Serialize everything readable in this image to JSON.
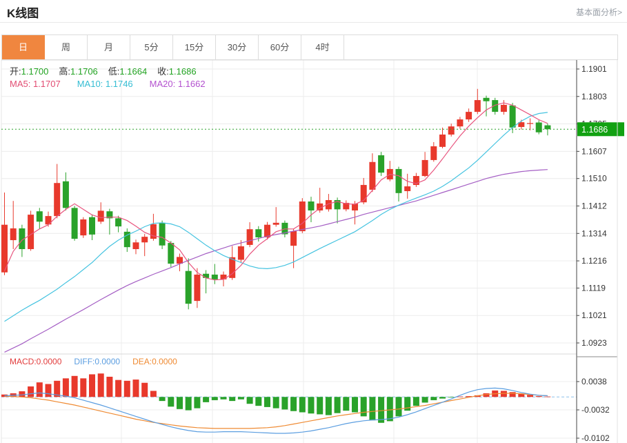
{
  "header": {
    "title": "K线图",
    "link_label": "基本面分析>"
  },
  "tabs": {
    "active_index": 0,
    "items": [
      "日",
      "周",
      "月",
      "5分",
      "15分",
      "30分",
      "60分",
      "4时"
    ]
  },
  "ohlc_bar": {
    "open_label": "开:",
    "open_value": "1.1700",
    "high_label": "高:",
    "high_value": "1.1706",
    "low_label": "低:",
    "low_value": "1.1664",
    "close_label": "收:",
    "close_value": "1.1686"
  },
  "ma_bar": {
    "ma5": "MA5: 1.1707",
    "ma10": "MA10: 1.1746",
    "ma20": "MA20: 1.1662"
  },
  "macd_bar": {
    "macd": "MACD:0.0000",
    "diff": "DIFF:0.0000",
    "dea": "DEA:0.0000"
  },
  "price_tag": "1.1686",
  "colors": {
    "up_red": "#e8392c",
    "down_green": "#2aa22a",
    "price_tag_bg": "#12a112",
    "value_green": "#21a321",
    "ma5_line": "#e8547e",
    "ma10_line": "#44c3e0",
    "ma20_line": "#a45ec4",
    "diff_line": "#5a9de0",
    "dea_line": "#ef8a32",
    "active_tab_bg": "#f0863f",
    "grid": "#ececec",
    "axis": "#444444",
    "zero_dash": "#8cc0ea"
  },
  "chart_data": {
    "type": "candlestick",
    "panes": [
      "price-with-ma",
      "macd"
    ],
    "legend": [
      "MA5",
      "MA10",
      "MA20",
      "MACD",
      "DIFF",
      "DEA"
    ],
    "grid": true,
    "y_ticks": [
      1.1901,
      1.1803,
      1.1705,
      1.1607,
      1.151,
      1.1412,
      1.1314,
      1.1216,
      1.1119,
      1.1021,
      1.0923
    ],
    "current_price": 1.1686,
    "last_ohlc": {
      "open": 1.17,
      "high": 1.1706,
      "low": 1.1664,
      "close": 1.1686
    },
    "candles_ohlc": [
      [
        1.1175,
        1.146,
        1.1165,
        1.1345
      ],
      [
        1.129,
        1.143,
        1.1258,
        1.1332
      ],
      [
        1.1332,
        1.1345,
        1.123,
        1.1258
      ],
      [
        1.1258,
        1.1395,
        1.1252,
        1.1381
      ],
      [
        1.1393,
        1.1405,
        1.133,
        1.1356
      ],
      [
        1.1346,
        1.1392,
        1.1338,
        1.1376
      ],
      [
        1.1376,
        1.1562,
        1.1368,
        1.1494
      ],
      [
        1.15,
        1.1532,
        1.1396,
        1.1405
      ],
      [
        1.1405,
        1.1412,
        1.1288,
        1.1295
      ],
      [
        1.1307,
        1.1372,
        1.1298,
        1.1364
      ],
      [
        1.1372,
        1.1382,
        1.129,
        1.131
      ],
      [
        1.1356,
        1.1425,
        1.1348,
        1.1395
      ],
      [
        1.1393,
        1.1402,
        1.131,
        1.1368
      ],
      [
        1.1368,
        1.1377,
        1.1318,
        1.1339
      ],
      [
        1.132,
        1.1332,
        1.1248,
        1.1265
      ],
      [
        1.1258,
        1.1292,
        1.124,
        1.1282
      ],
      [
        1.1282,
        1.1312,
        1.1233,
        1.1302
      ],
      [
        1.1295,
        1.1384,
        1.1288,
        1.1347
      ],
      [
        1.1352,
        1.136,
        1.1258,
        1.1271
      ],
      [
        1.128,
        1.1287,
        1.1194,
        1.1206
      ],
      [
        1.1206,
        1.1242,
        1.1179,
        1.123
      ],
      [
        1.118,
        1.1225,
        1.1043,
        1.1063
      ],
      [
        1.1073,
        1.119,
        1.1048,
        1.1167
      ],
      [
        1.117,
        1.1183,
        1.11,
        1.1155
      ],
      [
        1.1167,
        1.1205,
        1.1133,
        1.115
      ],
      [
        1.115,
        1.1178,
        1.1125,
        1.1167
      ],
      [
        1.1155,
        1.1269,
        1.1148,
        1.1229
      ],
      [
        1.122,
        1.129,
        1.121,
        1.1268
      ],
      [
        1.1273,
        1.1354,
        1.1265,
        1.1329
      ],
      [
        1.1329,
        1.134,
        1.1285,
        1.13
      ],
      [
        1.13,
        1.1355,
        1.1292,
        1.1345
      ],
      [
        1.1345,
        1.1408,
        1.1338,
        1.1352
      ],
      [
        1.1352,
        1.136,
        1.13,
        1.1311
      ],
      [
        1.127,
        1.133,
        1.119,
        1.1322
      ],
      [
        1.1322,
        1.144,
        1.1315,
        1.1428
      ],
      [
        1.1428,
        1.1445,
        1.1354,
        1.1396
      ],
      [
        1.1396,
        1.1477,
        1.1388,
        1.1421
      ],
      [
        1.14,
        1.1455,
        1.1392,
        1.1433
      ],
      [
        1.1433,
        1.1442,
        1.135,
        1.14
      ],
      [
        1.14,
        1.1432,
        1.1393,
        1.1423
      ],
      [
        1.1396,
        1.143,
        1.1346,
        1.142
      ],
      [
        1.1425,
        1.1512,
        1.1418,
        1.1487
      ],
      [
        1.147,
        1.16,
        1.1462,
        1.1569
      ],
      [
        1.1593,
        1.1605,
        1.1519,
        1.1531
      ],
      [
        1.1507,
        1.1573,
        1.15,
        1.1544
      ],
      [
        1.1544,
        1.1552,
        1.1428,
        1.1458
      ],
      [
        1.1465,
        1.1527,
        1.1438,
        1.1482
      ],
      [
        1.1487,
        1.153,
        1.148,
        1.1519
      ],
      [
        1.1519,
        1.1605,
        1.1515,
        1.1576
      ],
      [
        1.1576,
        1.164,
        1.157,
        1.1625
      ],
      [
        1.1623,
        1.1692,
        1.1618,
        1.1667
      ],
      [
        1.1667,
        1.1706,
        1.166,
        1.1696
      ],
      [
        1.1696,
        1.173,
        1.1688,
        1.1721
      ],
      [
        1.1721,
        1.176,
        1.1712,
        1.1748
      ],
      [
        1.1748,
        1.183,
        1.174,
        1.179
      ],
      [
        1.1798,
        1.1806,
        1.1732,
        1.1786
      ],
      [
        1.179,
        1.1798,
        1.1738,
        1.1748
      ],
      [
        1.1748,
        1.179,
        1.1738,
        1.1773
      ],
      [
        1.1771,
        1.178,
        1.1672,
        1.1692
      ],
      [
        1.1694,
        1.172,
        1.1685,
        1.1711
      ],
      [
        1.1705,
        1.1725,
        1.1682,
        1.1708
      ],
      [
        1.171,
        1.1718,
        1.1668,
        1.1675
      ],
      [
        1.17,
        1.1706,
        1.1664,
        1.1686
      ]
    ],
    "ma5": [
      1.118,
      1.125,
      1.129,
      1.131,
      1.133,
      1.1345,
      1.1375,
      1.14,
      1.142,
      1.14,
      1.138,
      1.137,
      1.1372,
      1.1372,
      1.136,
      1.134,
      1.1318,
      1.1305,
      1.13,
      1.128,
      1.1255,
      1.121,
      1.1175,
      1.1155,
      1.1148,
      1.115,
      1.117,
      1.12,
      1.124,
      1.1272,
      1.1295,
      1.132,
      1.133,
      1.133,
      1.135,
      1.138,
      1.1404,
      1.142,
      1.1428,
      1.142,
      1.1418,
      1.1432,
      1.1468,
      1.1505,
      1.1525,
      1.152,
      1.15,
      1.1492,
      1.1505,
      1.154,
      1.158,
      1.1622,
      1.1662,
      1.1697,
      1.1727,
      1.1755,
      1.1772,
      1.178,
      1.1772,
      1.1755,
      1.1738,
      1.172,
      1.1707
    ],
    "ma10": [
      1.1,
      1.102,
      1.104,
      1.1058,
      1.1075,
      1.1095,
      1.1115,
      1.1138,
      1.116,
      1.1185,
      1.121,
      1.124,
      1.1268,
      1.129,
      1.1308,
      1.1322,
      1.1338,
      1.135,
      1.1352,
      1.1348,
      1.1338,
      1.1318,
      1.1295,
      1.1272,
      1.1252,
      1.1235,
      1.1222,
      1.121,
      1.1198,
      1.119,
      1.1188,
      1.1192,
      1.12,
      1.1212,
      1.1228,
      1.1244,
      1.126,
      1.1275,
      1.129,
      1.1305,
      1.132,
      1.134,
      1.136,
      1.1382,
      1.14,
      1.1415,
      1.1428,
      1.144,
      1.1452,
      1.1465,
      1.1482,
      1.1502,
      1.1525,
      1.1548,
      1.1575,
      1.1605,
      1.1635,
      1.1665,
      1.1692,
      1.1715,
      1.1732,
      1.1742,
      1.1746
    ],
    "ma20": [
      1.089,
      1.0905,
      1.092,
      1.0938,
      1.0955,
      1.0972,
      1.099,
      1.1008,
      1.1025,
      1.1042,
      1.106,
      1.1078,
      1.1095,
      1.1112,
      1.1128,
      1.1142,
      1.1155,
      1.1168,
      1.118,
      1.1192,
      1.1205,
      1.1218,
      1.123,
      1.1242,
      1.1252,
      1.1262,
      1.1272,
      1.128,
      1.1288,
      1.1296,
      1.1304,
      1.131,
      1.1316,
      1.1322,
      1.1328,
      1.1334,
      1.134,
      1.1348,
      1.1356,
      1.1364,
      1.1372,
      1.1382,
      1.139,
      1.1398,
      1.1406,
      1.1414,
      1.1422,
      1.143,
      1.144,
      1.145,
      1.146,
      1.147,
      1.148,
      1.149,
      1.15,
      1.151,
      1.1518,
      1.1525,
      1.153,
      1.1535,
      1.1538,
      1.154,
      1.1542
    ],
    "macd": {
      "value_unit": 0.0001,
      "ticks": [
        0.0038,
        -0.0032,
        -0.0102
      ],
      "hist": [
        6,
        9,
        14,
        26,
        36,
        32,
        40,
        46,
        52,
        46,
        56,
        58,
        50,
        42,
        40,
        43,
        35,
        15,
        -10,
        -24,
        -30,
        -33,
        -28,
        -13,
        -8,
        -6,
        -10,
        -6,
        -17,
        -22,
        -25,
        -28,
        -31,
        -35,
        -38,
        -41,
        -43,
        -45,
        -40,
        -34,
        -38,
        -48,
        -58,
        -64,
        -60,
        -48,
        -34,
        -22,
        -14,
        -8,
        -4,
        -1,
        1,
        2,
        4,
        9,
        16,
        15,
        12,
        8,
        5,
        2,
        1
      ],
      "diff": [
        3,
        4,
        5,
        8,
        10,
        8,
        5,
        2,
        -2,
        -8,
        -14,
        -20,
        -27,
        -34,
        -41,
        -48,
        -55,
        -62,
        -68,
        -74,
        -79,
        -83,
        -86,
        -87,
        -87,
        -86,
        -86,
        -86,
        -87,
        -88,
        -89,
        -90,
        -90,
        -89,
        -87,
        -84,
        -80,
        -76,
        -71,
        -66,
        -62,
        -59,
        -57,
        -56,
        -54,
        -50,
        -44,
        -37,
        -29,
        -21,
        -13,
        -5,
        4,
        12,
        18,
        21,
        22,
        20,
        16,
        11,
        7,
        4,
        3
      ],
      "dea": [
        2,
        1,
        0,
        -2,
        -5,
        -8,
        -12,
        -16,
        -20,
        -25,
        -30,
        -35,
        -40,
        -45,
        -50,
        -55,
        -59,
        -63,
        -66,
        -69,
        -72,
        -74,
        -76,
        -77,
        -78,
        -78,
        -78,
        -78,
        -78,
        -77,
        -76,
        -74,
        -71,
        -67,
        -63,
        -59,
        -55,
        -51,
        -47,
        -44,
        -41,
        -38,
        -36,
        -34,
        -32,
        -30,
        -27,
        -24,
        -21,
        -17,
        -13,
        -9,
        -5,
        -1,
        3,
        6,
        8,
        9,
        9,
        8,
        6,
        4,
        3
      ]
    }
  }
}
